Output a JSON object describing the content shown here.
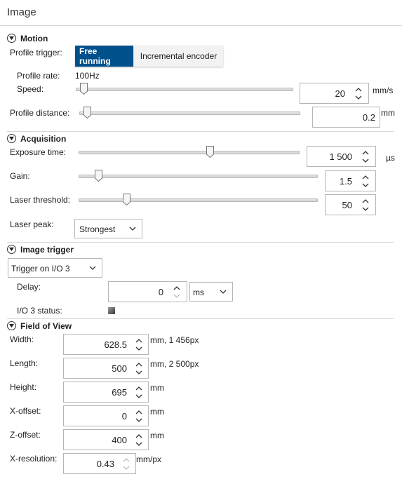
{
  "panel": {
    "title": "Image"
  },
  "motion": {
    "title": "Motion",
    "profile_trigger_label": "Profile trigger:",
    "trigger_options": [
      "Free running",
      "Incremental encoder"
    ],
    "trigger_selected": "Free running",
    "profile_rate_label": "Profile rate:",
    "profile_rate_value": "100Hz",
    "speed_label": "Speed:",
    "speed_value": "20",
    "speed_unit": "mm/s",
    "speed_slider_fraction": 0.02,
    "distance_label": "Profile distance:",
    "distance_value": "0.2",
    "distance_unit": "mm",
    "distance_slider_fraction": 0.02
  },
  "acquisition": {
    "title": "Acquisition",
    "exposure_label": "Exposure time:",
    "exposure_value": "1 500",
    "exposure_unit": "µs",
    "exposure_slider_fraction": 0.6,
    "gain_label": "Gain:",
    "gain_value": "1.5",
    "gain_slider_fraction": 0.07,
    "threshold_label": "Laser threshold:",
    "threshold_value": "50",
    "threshold_slider_fraction": 0.19,
    "peak_label": "Laser peak:",
    "peak_value": "Strongest"
  },
  "image_trigger": {
    "title": "Image trigger",
    "mode_value": "Trigger on I/O 3",
    "delay_label": "Delay:",
    "delay_value": "0",
    "delay_unit": "ms",
    "io_status_label": "I/O 3 status:"
  },
  "fov": {
    "title": "Field of View",
    "fields": [
      {
        "label": "Width:",
        "value": "628.5",
        "unit": "mm, 1 456px"
      },
      {
        "label": "Length:",
        "value": "500",
        "unit": "mm, 2 500px"
      },
      {
        "label": "Height:",
        "value": "695",
        "unit": "mm"
      },
      {
        "label": "X-offset:",
        "value": "0",
        "unit": "mm"
      },
      {
        "label": "Z-offset:",
        "value": "400",
        "unit": "mm"
      },
      {
        "label": "X-resolution:",
        "value": "0.43",
        "unit": "mm/px"
      }
    ]
  },
  "colors": {
    "accent": "#00508c",
    "divider": "#d6d6d6",
    "border": "#b5b5b5"
  }
}
